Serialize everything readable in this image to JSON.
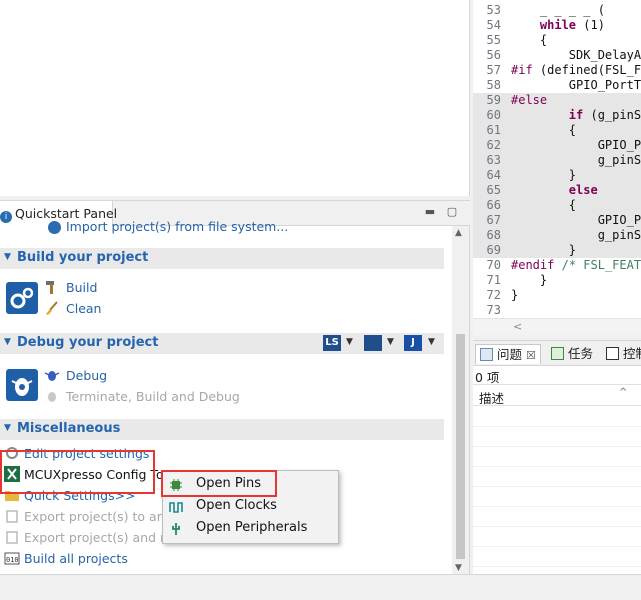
{
  "code_editor": {
    "lines": [
      {
        "num": "53",
        "text": "    _ _ _ _ ("
      },
      {
        "num": "54",
        "text": "    while (1)"
      },
      {
        "num": "55",
        "text": "    {"
      },
      {
        "num": "56",
        "text": "        SDK_DelayAt"
      },
      {
        "num": "57",
        "text": "#if (defined(FSL_FE"
      },
      {
        "num": "58",
        "text": "        GPIO_PortTo"
      },
      {
        "num": "59",
        "text": "#else"
      },
      {
        "num": "60",
        "text": "        if (g_pinSe"
      },
      {
        "num": "61",
        "text": "        {"
      },
      {
        "num": "62",
        "text": "            GPIO_Pi"
      },
      {
        "num": "63",
        "text": "            g_pinSe"
      },
      {
        "num": "64",
        "text": "        }"
      },
      {
        "num": "65",
        "text": "        else"
      },
      {
        "num": "66",
        "text": "        {"
      },
      {
        "num": "67",
        "text": "            GPIO_Pi"
      },
      {
        "num": "68",
        "text": "            g_pinSe"
      },
      {
        "num": "69",
        "text": "        }"
      },
      {
        "num": "70",
        "text": "#endif /* FSL_FEATU"
      },
      {
        "num": "71",
        "text": "    }"
      },
      {
        "num": "72",
        "text": "}"
      },
      {
        "num": "73",
        "text": ""
      }
    ],
    "scroll_left_arrow": "<"
  },
  "problems_panel": {
    "tabs": [
      {
        "label": "问题",
        "close": "☒",
        "icon": "problems-icon"
      },
      {
        "label": "任务",
        "icon": "tasks-icon"
      },
      {
        "label": "控制",
        "icon": "console-icon"
      }
    ],
    "count": "0 项",
    "column_header": "描述",
    "sort_caret": "^"
  },
  "quickstart": {
    "tab_label": "Quickstart Panel",
    "import_link": "Import project(s) from file system...",
    "build_section": {
      "title": "Build your project",
      "build": "Build",
      "clean": "Clean"
    },
    "debug_section": {
      "title": "Debug your project",
      "toolbar": [
        "LS",
        "",
        "J"
      ],
      "debug": "Debug",
      "terminate": "Terminate, Build and Debug"
    },
    "misc_section": {
      "title": "Miscellaneous",
      "edit_settings": "Edit project settings",
      "mcuxpresso": "MCUXpresso Config To",
      "quick_settings": "Quick Settings>>",
      "export_archive": "Export project(s) to arch",
      "export_ref": "Export project(s) and re",
      "build_all": "Build all projects"
    }
  },
  "context_menu": {
    "items": [
      {
        "label": "Open Pins",
        "icon": "pins-chip-icon"
      },
      {
        "label": "Open Clocks",
        "icon": "clock-wave-icon"
      },
      {
        "label": "Open Peripherals",
        "icon": "peripheral-plug-icon"
      }
    ]
  },
  "colors": {
    "link": "#2563a8",
    "section_title": "#2564ae",
    "highlight_red": "#e53535"
  }
}
